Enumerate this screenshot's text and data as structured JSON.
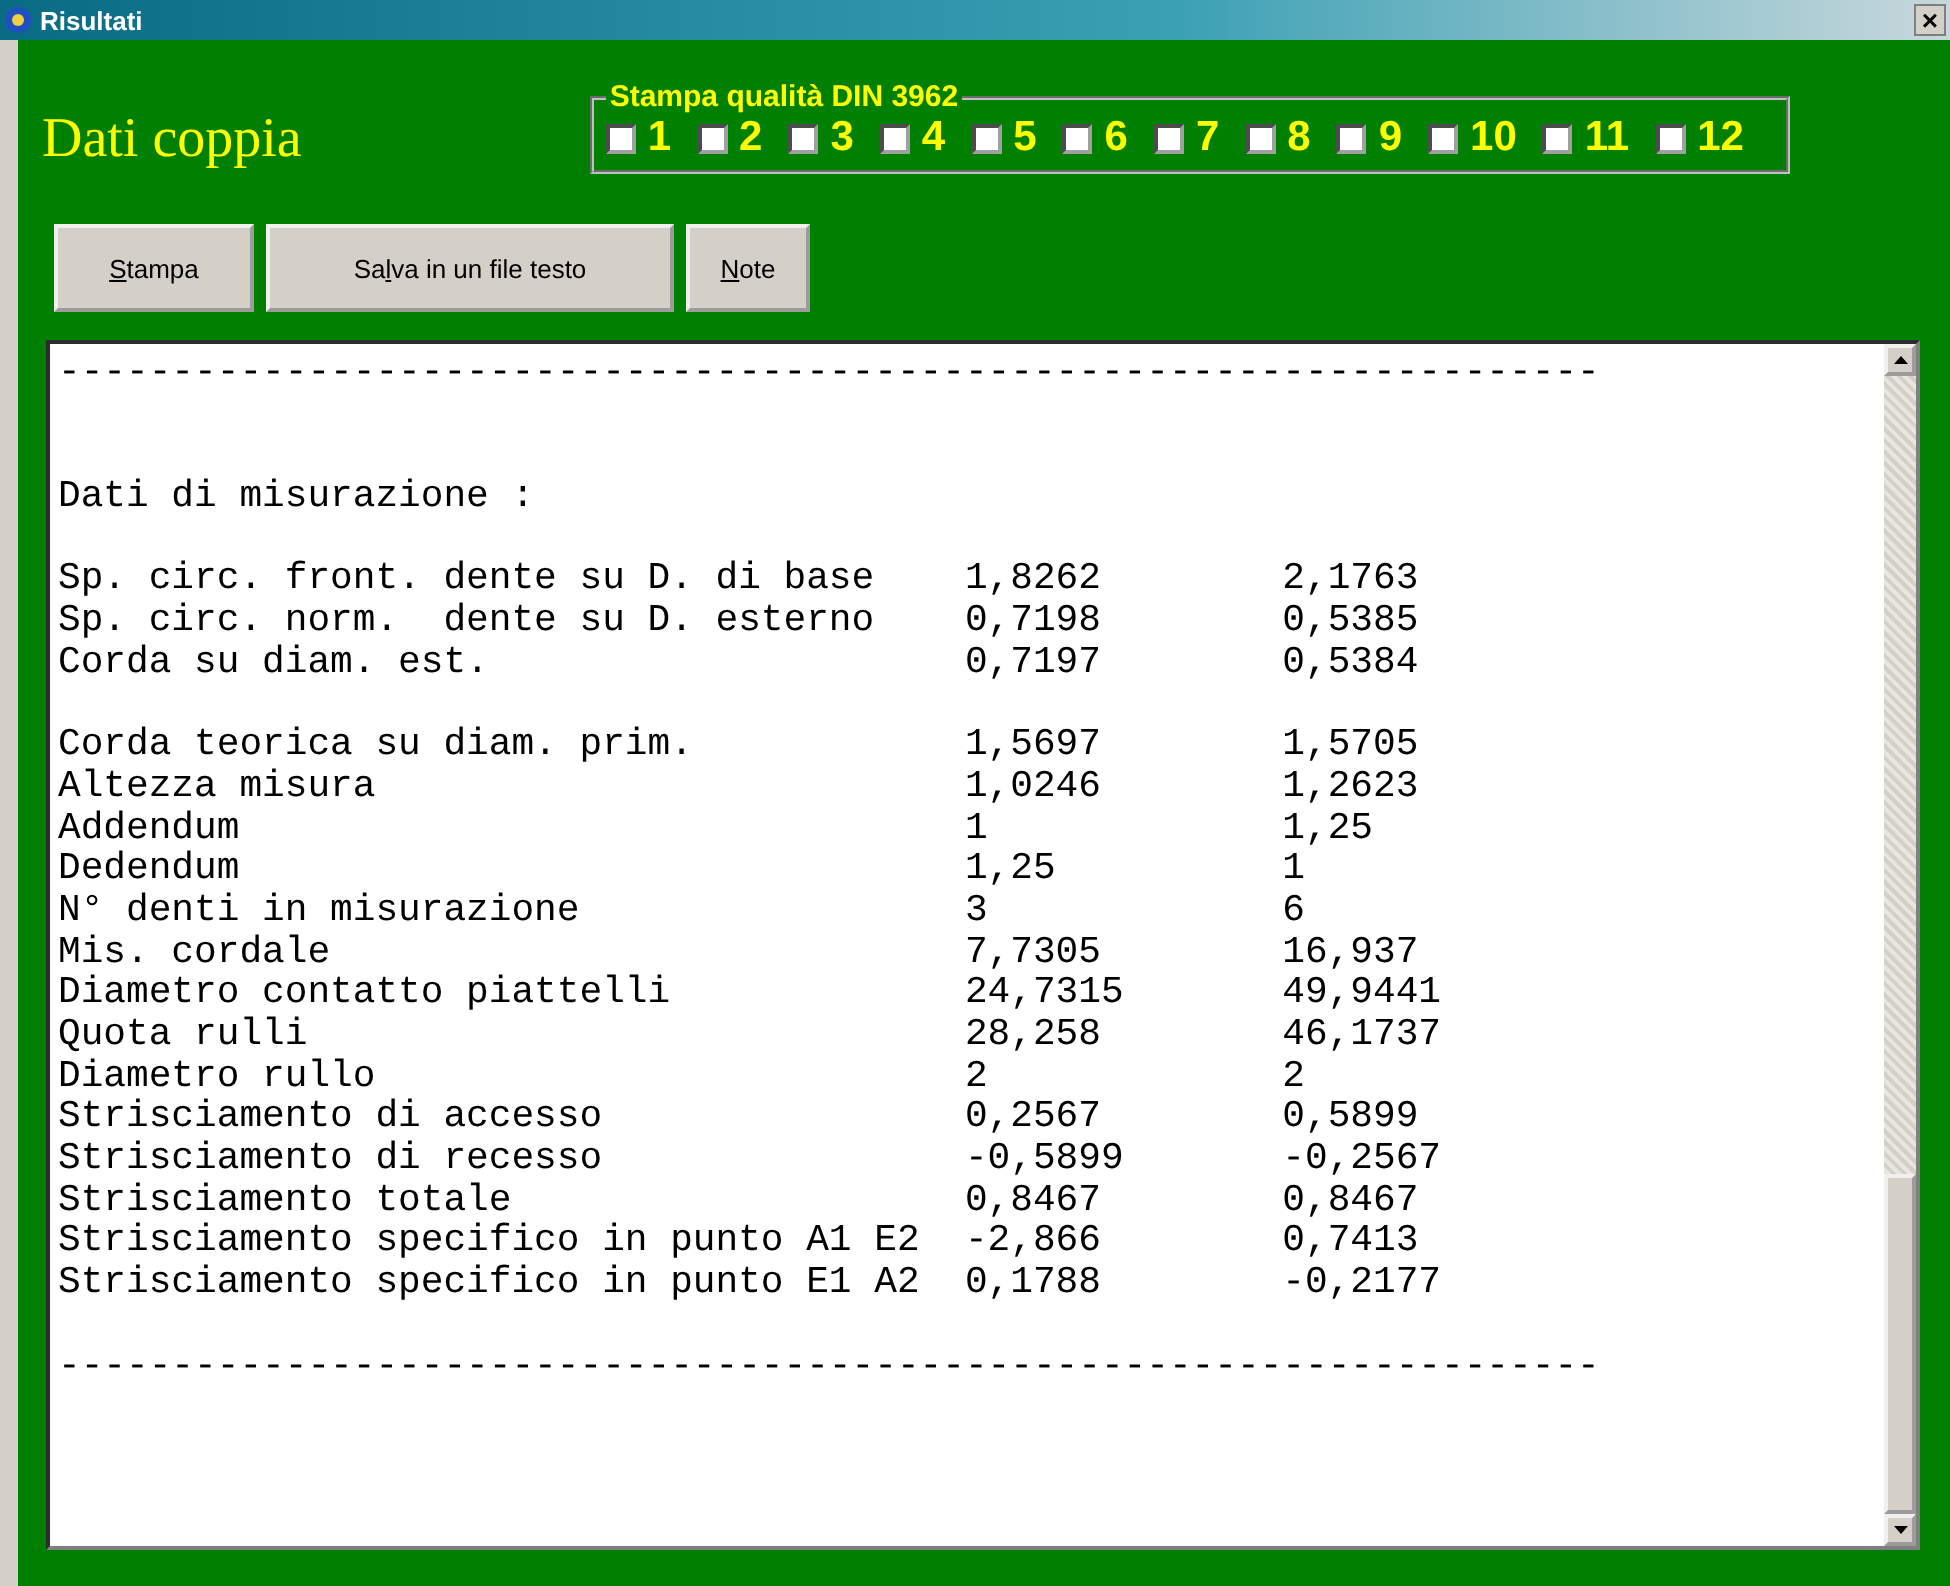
{
  "window": {
    "title": "Risultati",
    "close": "×"
  },
  "heading": "Dati coppia",
  "quality_group": {
    "legend": "Stampa qualità DIN 3962",
    "options": [
      {
        "label": "1",
        "checked": false
      },
      {
        "label": "2",
        "checked": false
      },
      {
        "label": "3",
        "checked": false
      },
      {
        "label": "4",
        "checked": false
      },
      {
        "label": "5",
        "checked": false
      },
      {
        "label": "6",
        "checked": false
      },
      {
        "label": "7",
        "checked": false
      },
      {
        "label": "8",
        "checked": false
      },
      {
        "label": "9",
        "checked": false
      },
      {
        "label": "10",
        "checked": false
      },
      {
        "label": "11",
        "checked": false
      },
      {
        "label": "12",
        "checked": false
      }
    ]
  },
  "buttons": [
    {
      "mnemonic": "S",
      "after": "tampa"
    },
    {
      "before": "Sa",
      "mnemonic": "l",
      "after": "va in un file testo"
    },
    {
      "mnemonic": "N",
      "after": "ote"
    }
  ],
  "report": [
    {
      "kind": "rule",
      "text": "--------------------------------------------------------------------"
    },
    {
      "kind": "blank"
    },
    {
      "kind": "blank"
    },
    {
      "kind": "heading",
      "text": "Dati di misurazione :"
    },
    {
      "kind": "blank"
    },
    {
      "kind": "data",
      "label": "Sp. circ. front. dente su D. di base",
      "value_1": "1,8262",
      "value_2": "2,1763"
    },
    {
      "kind": "data",
      "label": "Sp. circ. norm.  dente su D. esterno",
      "value_1": "0,7198",
      "value_2": "0,5385"
    },
    {
      "kind": "data",
      "label": "Corda su diam. est.",
      "value_1": "0,7197",
      "value_2": "0,5384"
    },
    {
      "kind": "blank"
    },
    {
      "kind": "data",
      "label": "Corda teorica su diam. prim.",
      "value_1": "1,5697",
      "value_2": "1,5705"
    },
    {
      "kind": "data",
      "label": "Altezza misura",
      "value_1": "1,0246",
      "value_2": "1,2623"
    },
    {
      "kind": "data",
      "label": "Addendum",
      "value_1": "1",
      "value_2": "1,25"
    },
    {
      "kind": "data",
      "label": "Dedendum",
      "value_1": "1,25",
      "value_2": "1"
    },
    {
      "kind": "data",
      "label": "N° denti in misurazione",
      "value_1": "3",
      "value_2": "6"
    },
    {
      "kind": "data",
      "label": "Mis. cordale",
      "value_1": "7,7305",
      "value_2": "16,937"
    },
    {
      "kind": "data",
      "label": "Diametro contatto piattelli",
      "value_1": "24,7315",
      "value_2": "49,9441"
    },
    {
      "kind": "data",
      "label": "Quota rulli",
      "value_1": "28,258",
      "value_2": "46,1737"
    },
    {
      "kind": "data",
      "label": "Diametro rullo",
      "value_1": "2",
      "value_2": "2"
    },
    {
      "kind": "data",
      "label": "Strisciamento di accesso",
      "value_1": "0,2567",
      "value_2": "0,5899"
    },
    {
      "kind": "data",
      "label": "Strisciamento di recesso",
      "value_1": "-0,5899",
      "value_2": "-0,2567"
    },
    {
      "kind": "data",
      "label": "Strisciamento totale",
      "value_1": "0,8467",
      "value_2": "0,8467"
    },
    {
      "kind": "data",
      "label": "Strisciamento specifico in punto A1 E2",
      "value_1": "-2,866",
      "value_2": "0,7413"
    },
    {
      "kind": "data",
      "label": "Strisciamento specifico in punto E1 A2",
      "value_1": "0,1788",
      "value_2": "-0,2177"
    },
    {
      "kind": "blank"
    },
    {
      "kind": "rule",
      "text": "--------------------------------------------------------------------"
    }
  ]
}
